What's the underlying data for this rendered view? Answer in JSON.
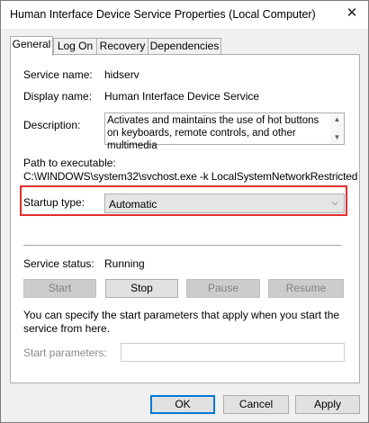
{
  "window": {
    "title": "Human Interface Device Service Properties (Local Computer)",
    "close_glyph": "✕"
  },
  "tabs": [
    {
      "label": "General",
      "active": true
    },
    {
      "label": "Log On",
      "active": false
    },
    {
      "label": "Recovery",
      "active": false
    },
    {
      "label": "Dependencies",
      "active": false
    }
  ],
  "general": {
    "service_name_label": "Service name:",
    "service_name": "hidserv",
    "display_name_label": "Display name:",
    "display_name": "Human Interface Device Service",
    "description_label": "Description:",
    "description": "Activates and maintains the use of hot buttons on keyboards, remote controls, and other multimedia",
    "path_label": "Path to executable:",
    "path": "C:\\WINDOWS\\system32\\svchost.exe -k LocalSystemNetworkRestricted",
    "startup_type_label": "Startup type:",
    "startup_type": "Automatic",
    "status_label": "Service status:",
    "status": "Running",
    "buttons": {
      "start": "Start",
      "stop": "Stop",
      "pause": "Pause",
      "resume": "Resume"
    },
    "info_text": "You can specify the start parameters that apply when you start the service from here.",
    "start_params_label": "Start parameters:",
    "start_params_value": ""
  },
  "footer": {
    "ok": "OK",
    "cancel": "Cancel",
    "apply": "Apply"
  },
  "colors": {
    "highlight_border": "#e32d2d",
    "default_button_border": "#0078d7"
  },
  "icons": {
    "close": "close-icon",
    "scroll_up": "chevron-up-icon",
    "scroll_down": "chevron-down-icon",
    "dropdown": "chevron-down-icon"
  }
}
